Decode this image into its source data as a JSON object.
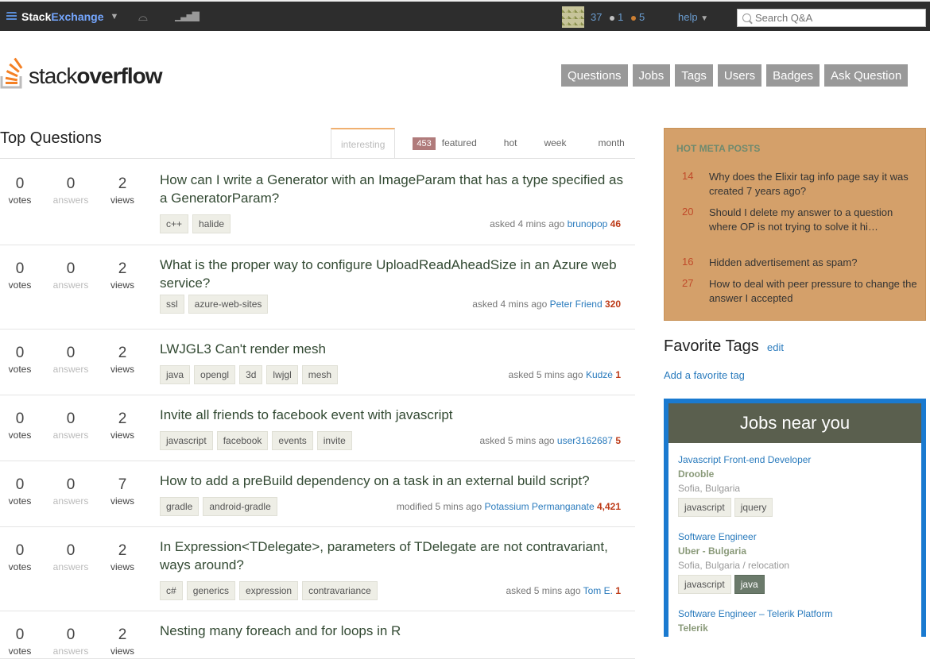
{
  "topbar": {
    "brand_stack": "Stack",
    "brand_exchange": "Exchange",
    "rep": "37",
    "silver": "1",
    "bronze": "5",
    "help_label": "help",
    "search_placeholder": "Search Q&A",
    "silver_color": "#c0c0c0",
    "bronze_color": "#cd7f32"
  },
  "header": {
    "logo_stack": "stack",
    "logo_overflow": "overflow",
    "nav": [
      "Questions",
      "Jobs",
      "Tags",
      "Users",
      "Badges",
      "Ask Question"
    ]
  },
  "main": {
    "title": "Top Questions",
    "tabs": [
      {
        "label": "interesting"
      },
      {
        "label": "featured",
        "count": "453"
      },
      {
        "label": "hot"
      },
      {
        "label": "week"
      },
      {
        "label": "month"
      }
    ],
    "questions": [
      {
        "votes": "0",
        "answers": "0",
        "views": "2",
        "title": "How can I write a Generator with an ImageParam that has a type specified as a GeneratorParam?",
        "tags": [
          "c++",
          "halide"
        ],
        "action": "asked 4 mins ago",
        "user": "brunopop",
        "rep": "46"
      },
      {
        "votes": "0",
        "answers": "0",
        "views": "2",
        "title": "What is the proper way to configure UploadReadAheadSize in an Azure web service?",
        "tags": [
          "ssl",
          "azure-web-sites"
        ],
        "action": "asked 4 mins ago",
        "user": "Peter Friend",
        "rep": "320"
      },
      {
        "votes": "0",
        "answers": "0",
        "views": "2",
        "title": "LWJGL3 Can't render mesh",
        "tags": [
          "java",
          "opengl",
          "3d",
          "lwjgl",
          "mesh"
        ],
        "action": "asked 5 mins ago",
        "user": "Kudzė",
        "rep": "1"
      },
      {
        "votes": "0",
        "answers": "0",
        "views": "2",
        "title": "Invite all friends to facebook event with javascript",
        "tags": [
          "javascript",
          "facebook",
          "events",
          "invite"
        ],
        "action": "asked 5 mins ago",
        "user": "user3162687",
        "rep": "5"
      },
      {
        "votes": "0",
        "answers": "0",
        "views": "7",
        "title": "How to add a preBuild dependency on a task in an external build script?",
        "tags": [
          "gradle",
          "android-gradle"
        ],
        "action": "modified 5 mins ago",
        "user": "Potassium Permanganate",
        "rep": "4,421"
      },
      {
        "votes": "0",
        "answers": "0",
        "views": "2",
        "title": "In Expression<TDelegate>, parameters of TDelegate are not contravariant, ways around?",
        "tags": [
          "c#",
          "generics",
          "expression",
          "contravariance"
        ],
        "action": "asked 5 mins ago",
        "user": "Tom E.",
        "rep": "1"
      },
      {
        "votes": "0",
        "answers": "0",
        "views": "2",
        "title": "Nesting many foreach and for loops in R",
        "tags": [],
        "action": "",
        "user": "",
        "rep": ""
      }
    ],
    "labels": {
      "votes": "votes",
      "answers": "answers",
      "views": "views"
    }
  },
  "sidebar": {
    "meta_title": "HOT META POSTS",
    "meta_posts": [
      {
        "count": "14",
        "title": "Why does the Elixir tag info page say it was created 7 years ago?"
      },
      {
        "count": "20",
        "title": "Should I delete my answer to a question where OP is not trying to solve it hi…"
      },
      {
        "count": "16",
        "title": "Hidden advertisement as spam?"
      },
      {
        "count": "27",
        "title": "How to deal with peer pressure to change the answer I accepted"
      }
    ],
    "fav_title": "Favorite Tags",
    "fav_edit": "edit",
    "fav_add": "Add a favorite tag",
    "jobs_title": "Jobs near you",
    "jobs": [
      {
        "title": "Javascript Front-end Developer",
        "company": "Drooble",
        "location": "Sofia, Bulgaria",
        "tags": [
          "javascript",
          "jquery"
        ]
      },
      {
        "title": "Software Engineer",
        "company": "Uber - Bulgaria",
        "location": "Sofia, Bulgaria / relocation",
        "tags": [
          "javascript",
          "java"
        ]
      },
      {
        "title": "Software Engineer – Telerik Platform",
        "company": "Telerik",
        "location": "",
        "tags": []
      }
    ]
  }
}
